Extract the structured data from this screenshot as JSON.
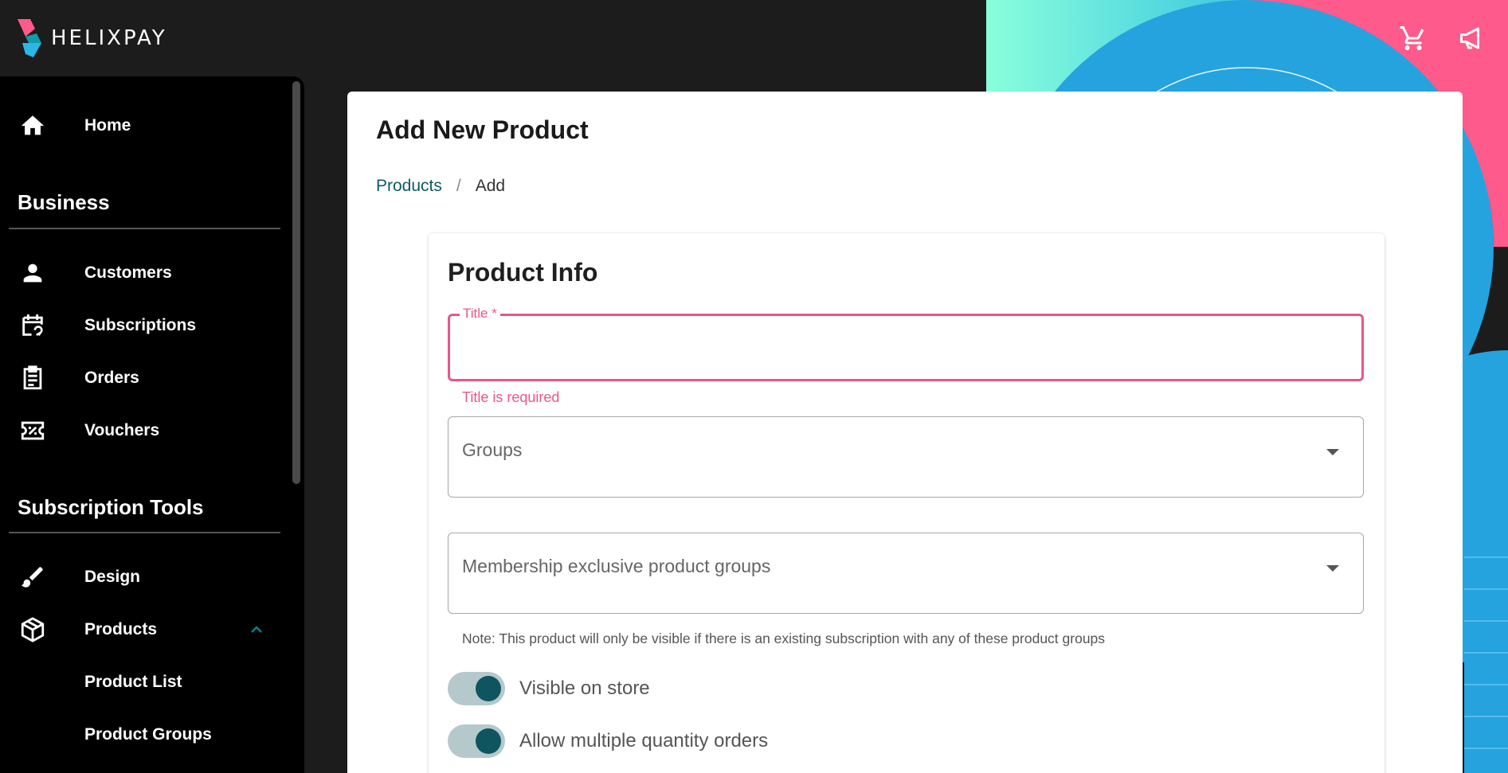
{
  "brand": {
    "name": "HELIXPAY"
  },
  "colors": {
    "accent_teal": "#0e555f",
    "error_pink": "#e8568b",
    "sidebar_bg": "#000000",
    "page_bg": "#1c1c1c",
    "deco_pink": "#ff5a8c",
    "deco_blue": "#25a3de",
    "deco_mint": "#7fffd4"
  },
  "header": {
    "icons": [
      "cart-icon",
      "megaphone-icon"
    ]
  },
  "sidebar": {
    "home": {
      "label": "Home",
      "icon": "home-icon"
    },
    "sections": [
      {
        "title": "Business",
        "items": [
          {
            "label": "Customers",
            "icon": "person-icon"
          },
          {
            "label": "Subscriptions",
            "icon": "calendar-sync-icon"
          },
          {
            "label": "Orders",
            "icon": "clipboard-icon"
          },
          {
            "label": "Vouchers",
            "icon": "voucher-icon"
          }
        ]
      },
      {
        "title": "Subscription Tools",
        "items": [
          {
            "label": "Design",
            "icon": "brush-icon"
          },
          {
            "label": "Products",
            "icon": "box-icon",
            "expanded": true
          },
          {
            "label": "Product List"
          },
          {
            "label": "Product Groups"
          }
        ]
      }
    ]
  },
  "main": {
    "page_title": "Add New Product",
    "breadcrumb": {
      "parent": "Products",
      "separator": "/",
      "current": "Add"
    },
    "card": {
      "title": "Product Info",
      "title_field": {
        "label": "Title *",
        "value": "",
        "error": "Title is required"
      },
      "groups_field": {
        "placeholder": "Groups"
      },
      "membership_field": {
        "placeholder": "Membership exclusive product groups",
        "note": "Note: This product will only be visible if there is an existing subscription with any of these product groups"
      },
      "toggles": [
        {
          "label": "Visible on store",
          "on": true
        },
        {
          "label": "Allow multiple quantity orders",
          "on": true
        }
      ]
    }
  }
}
